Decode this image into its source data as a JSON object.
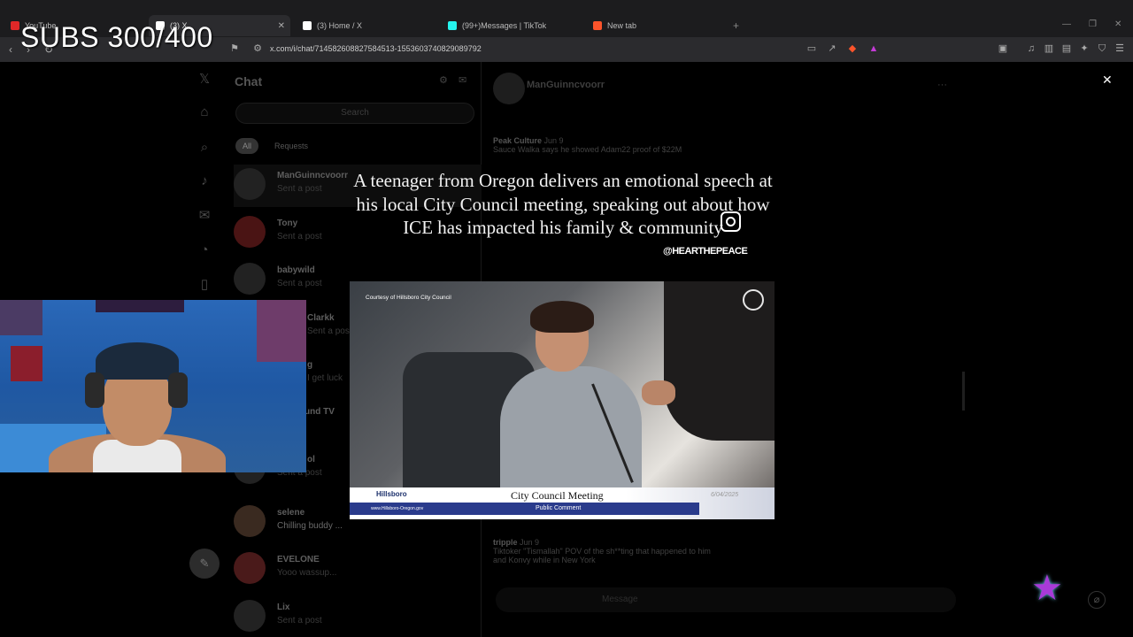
{
  "stream_overlay": {
    "subs_counter": "SUBS 300/400"
  },
  "browser": {
    "tabs": [
      {
        "label": "YouTube",
        "icon": "youtube-icon",
        "active": false
      },
      {
        "label": "(3) X",
        "icon": "x-logo-icon",
        "active": true
      },
      {
        "label": "(3) Home / X",
        "icon": "x-logo-icon",
        "active": false
      },
      {
        "label": "(99+)Messages | TikTok",
        "icon": "tiktok-icon",
        "active": false
      },
      {
        "label": "New tab",
        "icon": "brave-icon",
        "active": false
      }
    ],
    "url": "x.com/i/chat/714582608827584513-1553603740829089792"
  },
  "x_page": {
    "chat_title": "Chat",
    "search_placeholder": "Search",
    "filters": [
      "All",
      "Requests"
    ],
    "conversations": [
      {
        "name": "ManGuinncvoorr",
        "preview": "Sent a post"
      },
      {
        "name": "Tony",
        "preview": "Sent a post"
      },
      {
        "name": "babywild",
        "preview": "Sent a post"
      },
      {
        "name": "Clarkk",
        "preview": "Sent a post"
      },
      {
        "name": "g",
        "preview": "I get luck"
      },
      {
        "name": "und TV",
        "preview": ""
      },
      {
        "name": "ol",
        "preview": "Sent a post"
      },
      {
        "name": "selene",
        "preview": "Chilling buddy ..."
      },
      {
        "name": "EVELONE",
        "preview": "Yooo wassup..."
      },
      {
        "name": "Lix",
        "preview": "Sent a post"
      }
    ],
    "dm_header_name": "ManGuinncvoorr",
    "quotes": [
      {
        "author": "Peak Culture",
        "date": "Jun 9",
        "text": "Sauce Walka says he showed Adam22 proof of $22M"
      },
      {
        "author": "tripple",
        "date": "Jun 9",
        "text": "Tiktoker \"Tismallah\" POV of the sh**ting that happened to him and Konvy while in New York"
      }
    ],
    "composer_placeholder": "Message"
  },
  "post": {
    "caption": "A teenager from Oregon delivers an emotional speech at his local City Council meeting, speaking out about how ICE has impacted his family & community",
    "ig_handle": "@HEARTHEPEACE",
    "video": {
      "credit": "Courtesy of Hillsboro City Council",
      "lower_third_title": "City Council Meeting",
      "lower_third_sub": "Public Comment",
      "town": "Hillsboro",
      "website": "www.Hillsboro-Oregon.gov",
      "date": "6/04/2025"
    }
  }
}
